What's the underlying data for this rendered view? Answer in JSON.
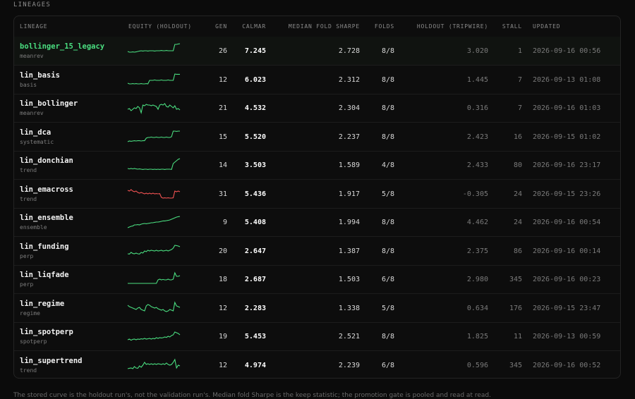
{
  "section_title": "LINEAGES",
  "columns": {
    "lineage": "LINEAGE",
    "equity": "EQUITY (HOLDOUT)",
    "gen": "GEN",
    "calmar": "CALMAR",
    "sharpe": "MEDIAN FOLD SHARPE",
    "folds": "FOLDS",
    "holdout": "HOLDOUT (TRIPWIRE)",
    "stall": "STALL",
    "updated": "UPDATED"
  },
  "colors": {
    "positive": "#4ade80",
    "negative": "#f05252"
  },
  "rows": [
    {
      "name": "bollinger_15_legacy",
      "kind": "meanrev",
      "gen": "26",
      "calmar": "7.245",
      "sharpe": "2.728",
      "folds": "8/8",
      "holdout": "3.020",
      "stall": "1",
      "updated": "2026-09-16 00:56",
      "trend": "up",
      "spark": [
        0.55,
        0.6,
        0.6,
        0.58,
        0.6,
        0.58,
        0.55,
        0.52,
        0.5,
        0.52,
        0.5,
        0.5,
        0.52,
        0.5,
        0.5,
        0.5,
        0.52,
        0.5,
        0.5,
        0.5,
        0.48,
        0.5,
        0.5,
        0.48,
        0.5,
        0.5,
        0.5,
        0.5,
        0.05,
        0.05,
        0.02,
        0.0
      ]
    },
    {
      "name": "lin_basis",
      "kind": "basis",
      "gen": "12",
      "calmar": "6.023",
      "sharpe": "2.312",
      "folds": "8/8",
      "holdout": "1.445",
      "stall": "7",
      "updated": "2026-09-13 01:08",
      "trend": "up",
      "spark": [
        0.75,
        0.8,
        0.8,
        0.78,
        0.8,
        0.78,
        0.8,
        0.8,
        0.78,
        0.8,
        0.8,
        0.78,
        0.8,
        0.55,
        0.55,
        0.55,
        0.52,
        0.55,
        0.55,
        0.55,
        0.52,
        0.55,
        0.55,
        0.55,
        0.52,
        0.55,
        0.55,
        0.55,
        0.1,
        0.12,
        0.12,
        0.12
      ]
    },
    {
      "name": "lin_bollinger",
      "kind": "meanrev",
      "gen": "21",
      "calmar": "4.532",
      "sharpe": "2.304",
      "folds": "8/8",
      "holdout": "0.316",
      "stall": "7",
      "updated": "2026-09-16 01:03",
      "trend": "up",
      "spark": [
        0.6,
        0.55,
        0.7,
        0.6,
        0.5,
        0.55,
        0.4,
        0.5,
        0.85,
        0.3,
        0.35,
        0.25,
        0.3,
        0.3,
        0.35,
        0.3,
        0.35,
        0.4,
        0.6,
        0.3,
        0.25,
        0.3,
        0.2,
        0.4,
        0.45,
        0.3,
        0.4,
        0.5,
        0.35,
        0.6,
        0.55,
        0.65
      ]
    },
    {
      "name": "lin_dca",
      "kind": "systematic",
      "gen": "15",
      "calmar": "5.520",
      "sharpe": "2.237",
      "folds": "8/8",
      "holdout": "2.423",
      "stall": "16",
      "updated": "2026-09-15 01:02",
      "trend": "up",
      "spark": [
        0.85,
        0.8,
        0.82,
        0.8,
        0.78,
        0.8,
        0.78,
        0.78,
        0.8,
        0.78,
        0.78,
        0.6,
        0.55,
        0.55,
        0.52,
        0.55,
        0.55,
        0.52,
        0.55,
        0.55,
        0.52,
        0.55,
        0.55,
        0.52,
        0.55,
        0.55,
        0.5,
        0.1,
        0.1,
        0.12,
        0.1,
        0.1
      ]
    },
    {
      "name": "lin_donchian",
      "kind": "trend",
      "gen": "14",
      "calmar": "3.503",
      "sharpe": "1.589",
      "folds": "4/8",
      "holdout": "2.433",
      "stall": "80",
      "updated": "2026-09-16 23:17",
      "trend": "up",
      "spark": [
        0.75,
        0.78,
        0.75,
        0.78,
        0.75,
        0.78,
        0.8,
        0.78,
        0.8,
        0.82,
        0.8,
        0.8,
        0.82,
        0.8,
        0.8,
        0.82,
        0.8,
        0.82,
        0.8,
        0.82,
        0.8,
        0.8,
        0.82,
        0.8,
        0.8,
        0.8,
        0.82,
        0.4,
        0.3,
        0.2,
        0.1,
        0.05
      ]
    },
    {
      "name": "lin_emacross",
      "kind": "trend",
      "gen": "31",
      "calmar": "5.436",
      "sharpe": "1.917",
      "folds": "5/8",
      "holdout": "-0.305",
      "stall": "24",
      "updated": "2026-09-15 23:26",
      "trend": "down",
      "spark": [
        0.25,
        0.3,
        0.2,
        0.3,
        0.35,
        0.3,
        0.4,
        0.45,
        0.4,
        0.45,
        0.5,
        0.45,
        0.5,
        0.45,
        0.5,
        0.45,
        0.5,
        0.48,
        0.5,
        0.48,
        0.75,
        0.8,
        0.78,
        0.8,
        0.78,
        0.8,
        0.8,
        0.78,
        0.3,
        0.35,
        0.3,
        0.35
      ]
    },
    {
      "name": "lin_ensemble",
      "kind": "ensemble",
      "gen": "9",
      "calmar": "5.408",
      "sharpe": "1.994",
      "folds": "8/8",
      "holdout": "4.462",
      "stall": "24",
      "updated": "2026-09-16 00:54",
      "trend": "up",
      "spark": [
        0.9,
        0.85,
        0.8,
        0.78,
        0.7,
        0.7,
        0.68,
        0.7,
        0.65,
        0.62,
        0.6,
        0.62,
        0.6,
        0.58,
        0.55,
        0.55,
        0.52,
        0.5,
        0.5,
        0.48,
        0.45,
        0.42,
        0.42,
        0.4,
        0.38,
        0.35,
        0.3,
        0.25,
        0.2,
        0.15,
        0.12,
        0.1
      ]
    },
    {
      "name": "lin_funding",
      "kind": "perp",
      "gen": "20",
      "calmar": "2.647",
      "sharpe": "1.387",
      "folds": "8/8",
      "holdout": "2.375",
      "stall": "86",
      "updated": "2026-09-16 00:14",
      "trend": "up",
      "spark": [
        0.7,
        0.72,
        0.6,
        0.68,
        0.7,
        0.65,
        0.7,
        0.72,
        0.6,
        0.65,
        0.5,
        0.55,
        0.45,
        0.5,
        0.45,
        0.48,
        0.5,
        0.45,
        0.5,
        0.48,
        0.45,
        0.5,
        0.48,
        0.45,
        0.5,
        0.45,
        0.4,
        0.3,
        0.1,
        0.12,
        0.15,
        0.2
      ]
    },
    {
      "name": "lin_liqfade",
      "kind": "perp",
      "gen": "18",
      "calmar": "2.687",
      "sharpe": "1.503",
      "folds": "6/8",
      "holdout": "2.980",
      "stall": "345",
      "updated": "2026-09-16 00:23",
      "trend": "up",
      "spark": [
        0.8,
        0.8,
        0.8,
        0.8,
        0.8,
        0.8,
        0.8,
        0.8,
        0.8,
        0.8,
        0.8,
        0.8,
        0.8,
        0.8,
        0.8,
        0.8,
        0.8,
        0.8,
        0.55,
        0.5,
        0.55,
        0.52,
        0.55,
        0.55,
        0.5,
        0.55,
        0.55,
        0.5,
        0.05,
        0.3,
        0.3,
        0.25
      ]
    },
    {
      "name": "lin_regime",
      "kind": "regime",
      "gen": "12",
      "calmar": "2.283",
      "sharpe": "1.338",
      "folds": "5/8",
      "holdout": "0.634",
      "stall": "176",
      "updated": "2026-09-15 23:47",
      "trend": "up",
      "spark": [
        0.3,
        0.4,
        0.45,
        0.5,
        0.55,
        0.6,
        0.5,
        0.45,
        0.6,
        0.65,
        0.7,
        0.35,
        0.25,
        0.3,
        0.4,
        0.45,
        0.5,
        0.45,
        0.55,
        0.6,
        0.65,
        0.6,
        0.7,
        0.75,
        0.7,
        0.6,
        0.65,
        0.7,
        0.1,
        0.35,
        0.4,
        0.45
      ]
    },
    {
      "name": "lin_spotperp",
      "kind": "spotperp",
      "gen": "19",
      "calmar": "5.453",
      "sharpe": "2.521",
      "folds": "8/8",
      "holdout": "1.825",
      "stall": "11",
      "updated": "2026-09-13 00:59",
      "trend": "up",
      "spark": [
        0.75,
        0.7,
        0.78,
        0.72,
        0.7,
        0.75,
        0.7,
        0.72,
        0.68,
        0.7,
        0.65,
        0.7,
        0.68,
        0.65,
        0.7,
        0.65,
        0.68,
        0.6,
        0.65,
        0.6,
        0.62,
        0.6,
        0.55,
        0.58,
        0.5,
        0.55,
        0.45,
        0.4,
        0.2,
        0.25,
        0.3,
        0.4
      ]
    },
    {
      "name": "lin_supertrend",
      "kind": "trend",
      "gen": "12",
      "calmar": "4.974",
      "sharpe": "2.239",
      "folds": "6/8",
      "holdout": "0.596",
      "stall": "345",
      "updated": "2026-09-16 00:52",
      "trend": "up",
      "spark": [
        0.75,
        0.72,
        0.7,
        0.75,
        0.6,
        0.7,
        0.72,
        0.55,
        0.65,
        0.5,
        0.3,
        0.45,
        0.4,
        0.45,
        0.4,
        0.45,
        0.4,
        0.45,
        0.4,
        0.42,
        0.45,
        0.4,
        0.45,
        0.35,
        0.45,
        0.5,
        0.45,
        0.3,
        0.1,
        0.7,
        0.5,
        0.55
      ]
    }
  ],
  "footer_text": "The stored curve is the holdout run's, not the validation run's. Median fold Sharpe is the keep statistic; the promotion gate is pooled and read at read."
}
